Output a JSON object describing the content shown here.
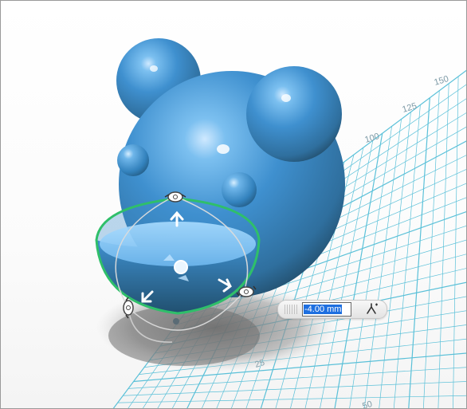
{
  "viewport": {
    "name": "3D modeling viewport"
  },
  "grid": {
    "labels": [
      "150",
      "125",
      "100",
      "25",
      "50"
    ],
    "color": "#3fb7d3"
  },
  "model": {
    "color": "#3f8fcf",
    "description_name": "blue sphere bear head"
  },
  "manipulator": {
    "ring_color": "#2fbf6a"
  },
  "dimension_input": {
    "value": "-4.00 mm",
    "snap_icon": "snap-icon"
  }
}
